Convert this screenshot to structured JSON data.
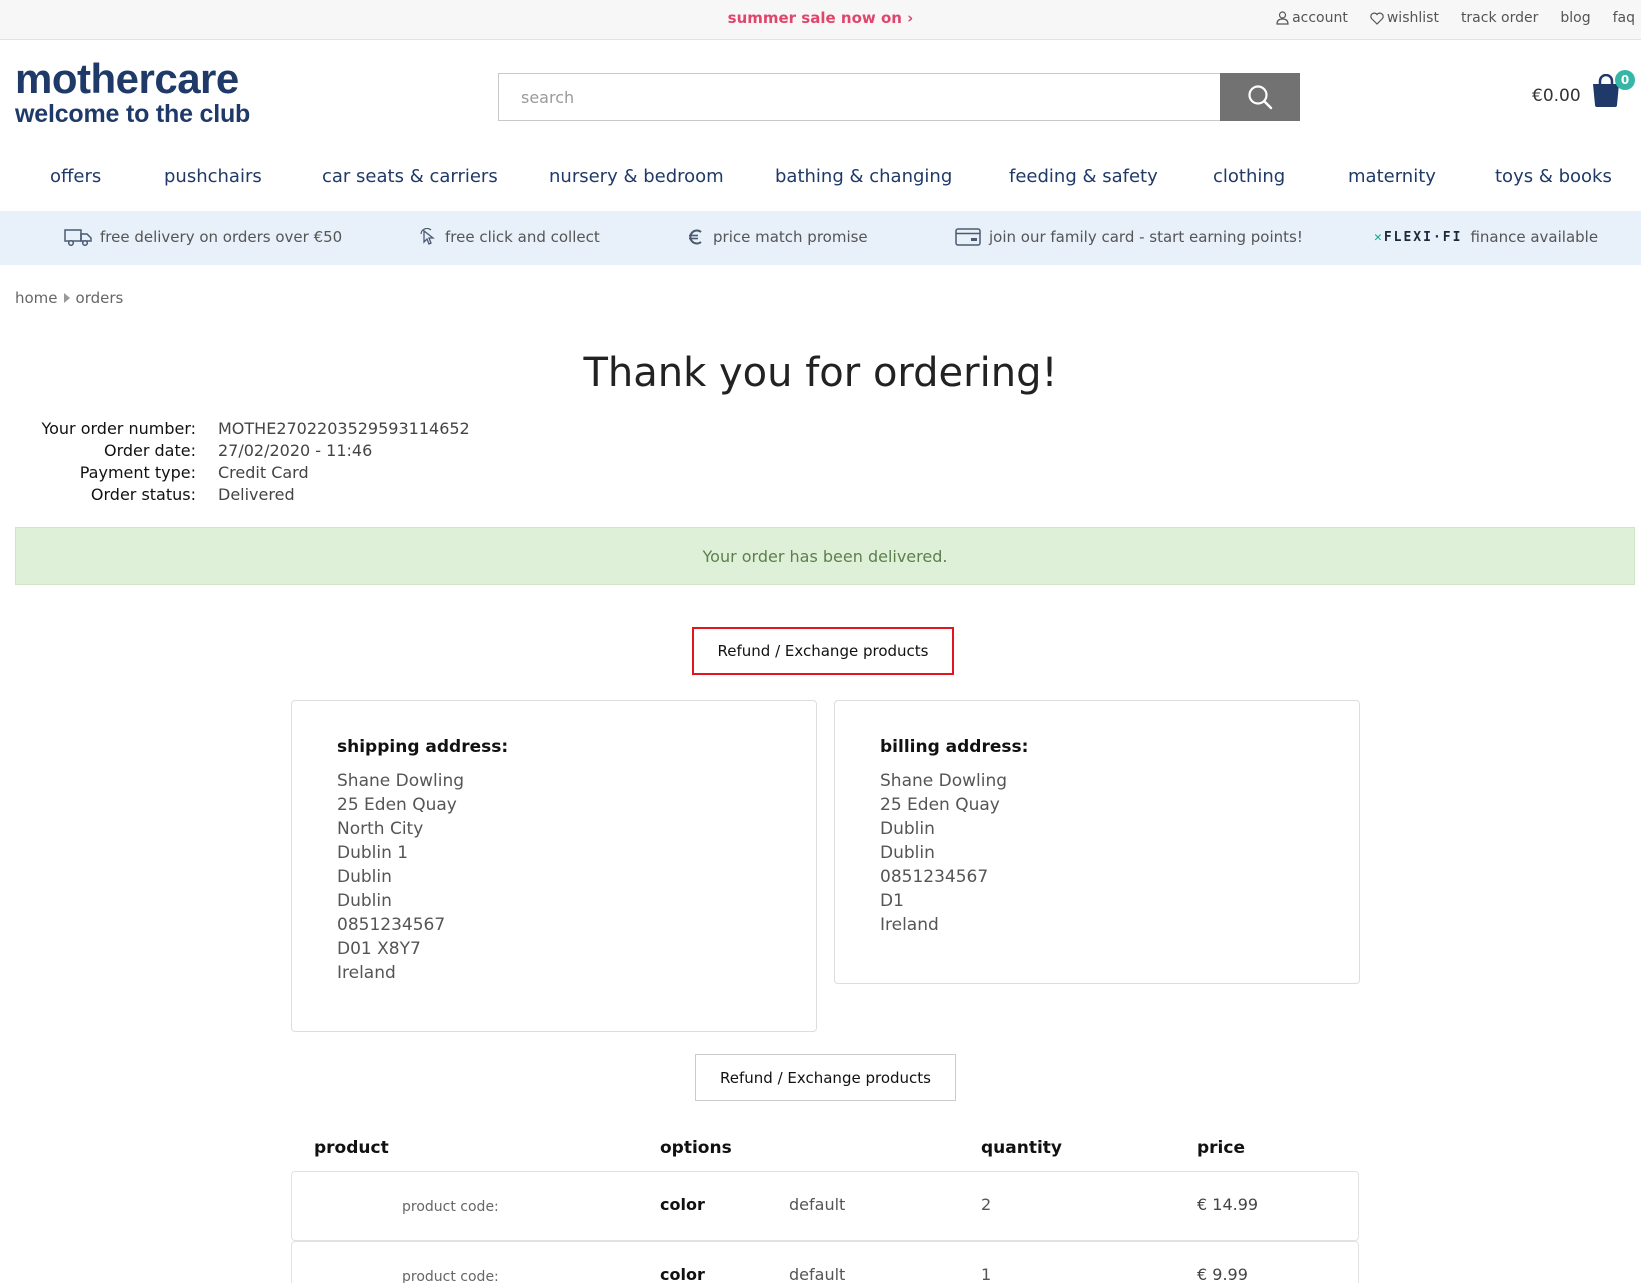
{
  "topbar": {
    "promo": "summer sale now on ›",
    "links": [
      "account",
      "wishlist",
      "track order",
      "blog",
      "faq"
    ]
  },
  "header": {
    "logo_line1": "mothercare",
    "logo_line2": "welcome to the club",
    "search_placeholder": "search",
    "cart_total": "€0.00",
    "cart_count": "0"
  },
  "nav": [
    "offers",
    "pushchairs",
    "car seats & carriers",
    "nursery & bedroom",
    "bathing & changing",
    "feeding & safety",
    "clothing",
    "maternity",
    "toys & books"
  ],
  "usp": {
    "delivery": "free delivery on orders over €50",
    "click_collect": "free click and collect",
    "price_match": "price match promise",
    "family_card": "join our family card - start earning points!",
    "flexifi_logo": "FLEXI·FI",
    "flexifi_text": "finance available"
  },
  "breadcrumb": [
    "home",
    "orders"
  ],
  "page_title": "Thank you for ordering!",
  "order_meta": {
    "labels": [
      "Your order number:",
      "Order date:",
      "Payment type:",
      "Order status:"
    ],
    "values": [
      "MOTHE27022035295931146​52",
      "27/02/2020 - 11:46",
      "Credit Card",
      "Delivered"
    ]
  },
  "alert": "Your order has been delivered.",
  "refund_button": "Refund / Exchange products",
  "shipping": {
    "title": "shipping address:",
    "lines": [
      "Shane Dowling",
      "25 Eden Quay",
      "North City",
      "Dublin 1",
      "Dublin",
      "Dublin",
      "0851234567",
      "D01 X8Y7",
      "Ireland"
    ]
  },
  "billing": {
    "title": "billing address:",
    "lines": [
      "Shane Dowling",
      "25 Eden Quay",
      "Dublin",
      "Dublin",
      "0851234567",
      "D1",
      "Ireland"
    ]
  },
  "table": {
    "headers": [
      "product",
      "options",
      "quantity",
      "price"
    ],
    "rows": [
      {
        "code_label": "product code:",
        "option_key": "color",
        "option_value": "default",
        "quantity": "2",
        "price": "€ 14.99"
      },
      {
        "code_label": "product code:",
        "option_key": "color",
        "option_value": "default",
        "quantity": "1",
        "price": "€ 9.99"
      }
    ]
  },
  "colors": {
    "brand": "#1f3a69",
    "promo": "#e0466b",
    "usp_bg": "#e8f0f9",
    "alert_bg": "#dff0d8",
    "highlight": "#e0161e",
    "cart_badge": "#35b6a6"
  }
}
